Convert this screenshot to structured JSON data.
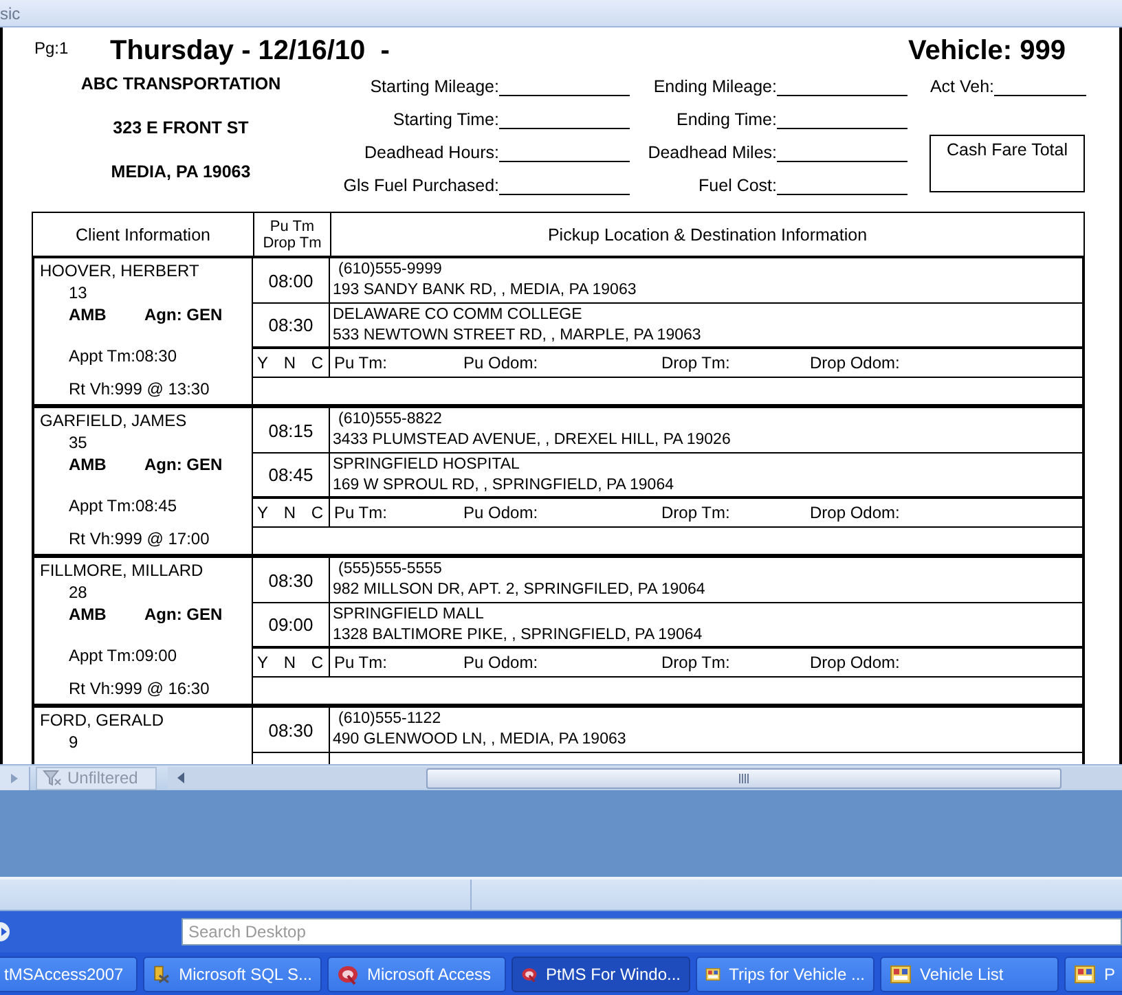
{
  "window": {
    "title": "sic"
  },
  "report": {
    "page": "Pg:1",
    "title": "Thursday - 12/16/10  -",
    "vehicle": "Vehicle: 999",
    "company": [
      "ABC TRANSPORTATION",
      "323 E FRONT ST",
      "MEDIA, PA 19063"
    ],
    "fields": [
      {
        "label": "Starting Mileage:"
      },
      {
        "label": "Ending Mileage:"
      },
      {
        "label": "Act Veh:"
      },
      {
        "label": "Starting Time:"
      },
      {
        "label": "Ending Time:"
      },
      {
        "label": "Deadhead Hours:"
      },
      {
        "label": "Deadhead Miles:"
      },
      {
        "label": "Gls Fuel Purchased:"
      },
      {
        "label": "Fuel Cost:"
      }
    ],
    "cash_box": "Cash Fare Total",
    "columns": [
      {
        "lines": [
          "Client Information"
        ]
      },
      {
        "lines": [
          "Pu Tm",
          "Drop Tm"
        ]
      },
      {
        "lines": [
          "Pickup Location & Destination Information"
        ]
      }
    ],
    "trips": [
      {
        "name": "HOOVER, HERBERT",
        "client_id": "13",
        "mode": "AMB",
        "agency": "Agn: GEN",
        "appt": "Appt Tm:08:30",
        "return": "Rt Vh:999 @ 13:30",
        "pickup_time": "08:00",
        "drop_time": "08:30",
        "pickup": [
          "(610)555-9999",
          "193 SANDY BANK RD, , MEDIA, PA 19063"
        ],
        "dropoff": [
          "DELAWARE CO COMM COLLEGE",
          "533 NEWTOWN STREET RD, , MARPLE, PA 19063"
        ],
        "confirm": [
          "Y",
          "N",
          "C"
        ],
        "log_labels": [
          "Pu Tm:",
          "Pu Odom:",
          "Drop Tm:",
          "Drop Odom:"
        ]
      },
      {
        "name": "GARFIELD, JAMES",
        "client_id": "35",
        "mode": "AMB",
        "agency": "Agn: GEN",
        "appt": "Appt Tm:08:45",
        "return": "Rt Vh:999 @ 17:00",
        "pickup_time": "08:15",
        "drop_time": "08:45",
        "pickup": [
          "(610)555-8822",
          "3433 PLUMSTEAD AVENUE, , DREXEL HILL, PA 19026"
        ],
        "dropoff": [
          "SPRINGFIELD HOSPITAL",
          "169 W SPROUL RD, , SPRINGFIELD, PA 19064"
        ],
        "confirm": [
          "Y",
          "N",
          "C"
        ],
        "log_labels": [
          "Pu Tm:",
          "Pu Odom:",
          "Drop Tm:",
          "Drop Odom:"
        ]
      },
      {
        "name": "FILLMORE, MILLARD",
        "client_id": "28",
        "mode": "AMB",
        "agency": "Agn: GEN",
        "appt": "Appt Tm:09:00",
        "return": "Rt Vh:999 @ 16:30",
        "pickup_time": "08:30",
        "drop_time": "09:00",
        "pickup": [
          "(555)555-5555",
          "982 MILLSON DR, APT. 2, SPRINGFILED, PA 19064"
        ],
        "dropoff": [
          "SPRINGFIELD MALL",
          "1328 BALTIMORE PIKE, , SPRINGFIELD, PA 19064"
        ],
        "confirm": [
          "Y",
          "N",
          "C"
        ],
        "log_labels": [
          "Pu Tm:",
          "Pu Odom:",
          "Drop Tm:",
          "Drop Odom:"
        ]
      },
      {
        "name": "FORD, GERALD",
        "client_id": "9",
        "pickup_time": "08:30",
        "pickup": [
          "(610)555-1122",
          "490 GLENWOOD LN, , MEDIA, PA 19063"
        ]
      }
    ]
  },
  "record_bar": {
    "filter": "Unfiltered"
  },
  "search": {
    "placeholder": "Search Desktop"
  },
  "taskbar": [
    {
      "label": "tMSAccess2007",
      "kind": "plain",
      "selected": false
    },
    {
      "label": "Microsoft SQL S...",
      "kind": "sql",
      "selected": false
    },
    {
      "label": "Microsoft Access",
      "kind": "access",
      "selected": false
    },
    {
      "label": "PtMS For Windo...",
      "kind": "access",
      "selected": true
    },
    {
      "label": "Trips for Vehicle ...",
      "kind": "form",
      "selected": false
    },
    {
      "label": "Vehicle List",
      "kind": "form",
      "selected": false
    },
    {
      "label": "P",
      "kind": "form",
      "selected": false
    }
  ]
}
